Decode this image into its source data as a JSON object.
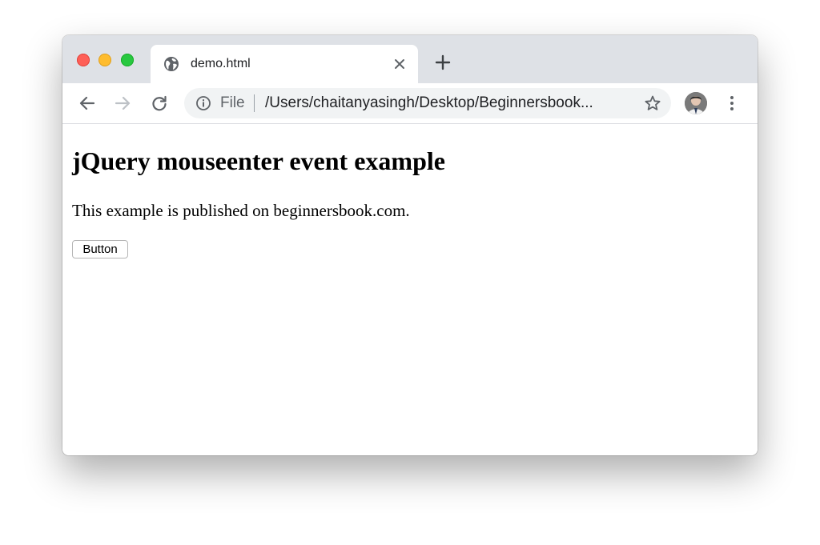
{
  "browser": {
    "tab": {
      "title": "demo.html"
    },
    "omnibox": {
      "scheme_label": "File",
      "url": "/Users/chaitanyasingh/Desktop/Beginnersbook..."
    }
  },
  "page": {
    "heading": "jQuery mouseenter event example",
    "paragraph": "This example is published on beginnersbook.com.",
    "button_label": "Button"
  },
  "colors": {
    "titlebar": "#dee1e6",
    "omnibox": "#f1f3f4",
    "close_light": "#fe5f57",
    "minimize_light": "#febc2e",
    "maximize_light": "#28c840"
  }
}
